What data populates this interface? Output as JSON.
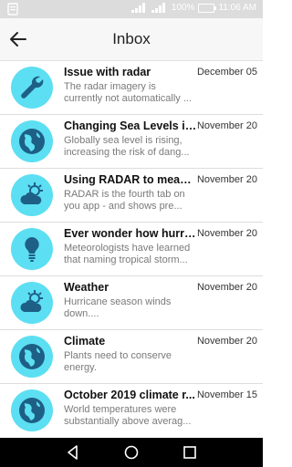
{
  "status_bar": {
    "battery": "100%",
    "time": "11:06 AM"
  },
  "app_bar": {
    "title": "Inbox"
  },
  "messages": [
    {
      "subject": "Issue with radar",
      "date": "December 05",
      "preview": "The radar imagery is currently not automatically ...",
      "icon": "wrench-icon"
    },
    {
      "subject": "Changing Sea Levels in ...",
      "date": "November 20",
      "preview": "Globally sea level is rising, increasing the risk of dang...",
      "icon": "globe-icon"
    },
    {
      "subject": "Using RADAR to measu...",
      "date": "November 20",
      "preview": "RADAR is the fourth tab on you app - and shows pre...",
      "icon": "cloud-sun-icon"
    },
    {
      "subject": "Ever wonder how hurric...",
      "date": "November 20",
      "preview": "Meteorologists have learned that naming tropical storm...",
      "icon": "lightbulb-icon"
    },
    {
      "subject": "Weather",
      "date": "November 20",
      "preview": "Hurricane season winds down....",
      "icon": "cloud-sun-icon"
    },
    {
      "subject": "Climate",
      "date": "November 20",
      "preview": "Plants need to conserve energy.",
      "icon": "globe-icon"
    },
    {
      "subject": "October 2019 climate r...",
      "date": "November 15",
      "preview": "World temperatures were substantially above averag...",
      "icon": "globe-icon"
    }
  ],
  "colors": {
    "avatar_bg": "#5cdff2",
    "icon_dark": "#1e5f86"
  }
}
